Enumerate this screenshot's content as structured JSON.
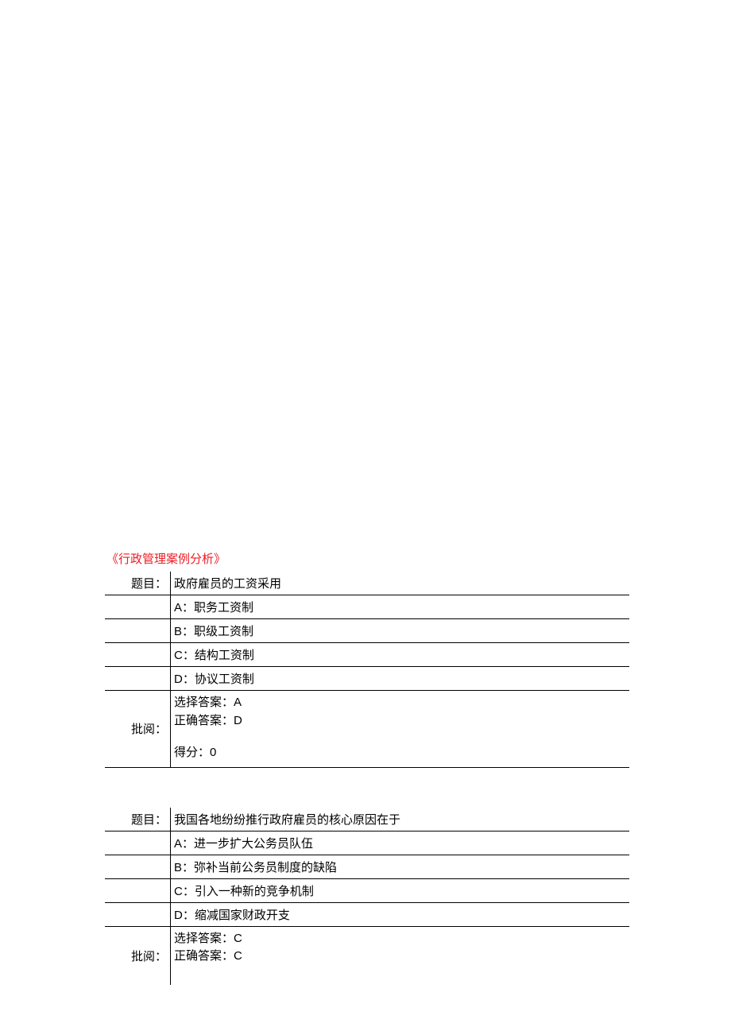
{
  "doc_title": "《行政管理案例分析》",
  "labels": {
    "question": "题目：",
    "review": "批阅：",
    "selected_prefix": "选择答案：",
    "correct_prefix": "正确答案：",
    "score_prefix": "得分："
  },
  "questions": [
    {
      "prompt": "政府雇员的工资采用",
      "options": {
        "A": "A：职务工资制",
        "B": "B：职级工资制",
        "C": "C：结构工资制",
        "D": "D：协议工资制"
      },
      "selected": "A",
      "correct": "D",
      "score": "0"
    },
    {
      "prompt": "我国各地纷纷推行政府雇员的核心原因在于",
      "options": {
        "A": "A：进一步扩大公务员队伍",
        "B": "B：弥补当前公务员制度的缺陷",
        "C": "C：引入一种新的竞争机制",
        "D": "D：缩减国家财政开支"
      },
      "selected": "C",
      "correct": "C",
      "score": ""
    }
  ]
}
